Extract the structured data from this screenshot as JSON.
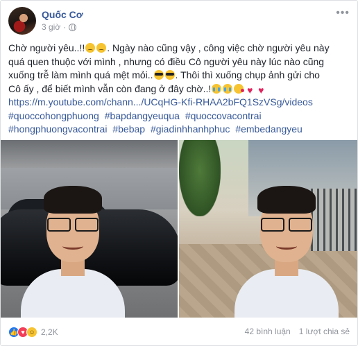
{
  "post": {
    "author": "Quốc Cơ",
    "time": "3 giờ",
    "privacy_icon": "globe-icon",
    "more_icon": "more-icon"
  },
  "body": {
    "line1": "Chờ người yêu..!!",
    "line1b": ". Ngày nào cũng vậy , công việc chờ người yêu này",
    "line2": "quá quen thuộc với mình , nhưng có điều Cô người yêu này lúc nào cũng",
    "line3": "xuống trễ làm mình quá mệt mỏi..",
    "line3b": ". Thôi thì xuống chụp ảnh gửi cho",
    "line4": "Cô ấy , để biết mình vẫn còn đang ở đây chờ..!",
    "link": "https://m.youtube.com/chann.../UCqHG-Kfi-RHAA2bFQ1SzVSg/videos",
    "hashtags_row1": [
      "#quoccohongphuong",
      "#bapdangyeuqua",
      "#quoccovacontrai"
    ],
    "hashtags_row2": [
      "#hongphuongvacontrai",
      "#bebap",
      "#giadinhhanhphuc",
      "#embedangyeu"
    ]
  },
  "footer": {
    "reaction_count": "2,2K",
    "comments": "42 bình luận",
    "shares": "1 lượt chia sẻ"
  },
  "colors": {
    "link": "#365899",
    "meta": "#90949c",
    "like": "#2078f4",
    "love": "#f33e58"
  }
}
